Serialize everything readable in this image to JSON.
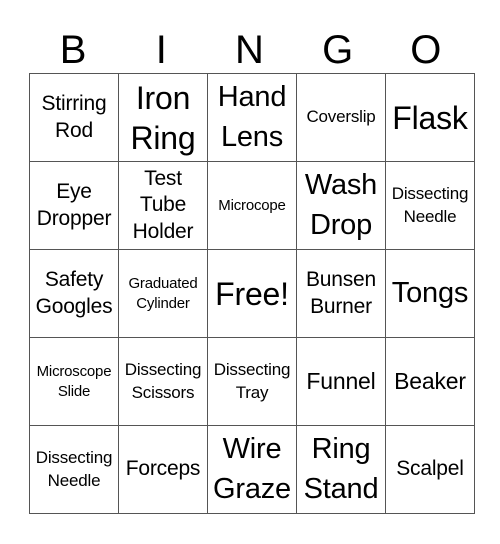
{
  "header": {
    "letters": [
      "B",
      "I",
      "N",
      "G",
      "O"
    ]
  },
  "card": {
    "rows": [
      [
        "Stirring Rod",
        "Iron Ring",
        "Hand Lens",
        "Coverslip",
        "Flask"
      ],
      [
        "Eye Dropper",
        "Test Tube Holder",
        "Microcope",
        "Wash Drop",
        "Dissecting Needle"
      ],
      [
        "Safety Googles",
        "Graduated Cylinder",
        "Free!",
        "Bunsen Burner",
        "Tongs"
      ],
      [
        "Microscope Slide",
        "Dissecting Scissors",
        "Dissecting Tray",
        "Funnel",
        "Beaker"
      ],
      [
        "Dissecting Needle",
        "Forceps",
        "Wire Graze",
        "Ring Stand",
        "Scalpel"
      ]
    ],
    "free_space": "Free!",
    "border_color": "#555555"
  }
}
